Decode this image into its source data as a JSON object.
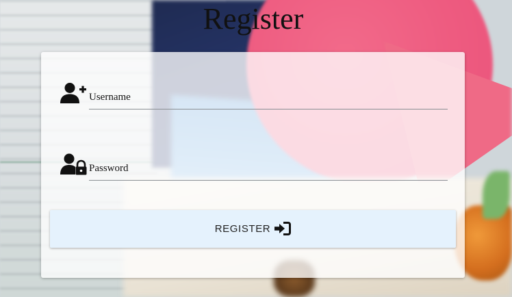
{
  "page": {
    "title": "Register"
  },
  "form": {
    "username": {
      "placeholder": "Username",
      "value": "",
      "icon": "user-plus-icon"
    },
    "password": {
      "placeholder": "Password",
      "value": "",
      "icon": "user-lock-icon"
    },
    "submit": {
      "label": "REGISTER",
      "icon": "sign-in-icon",
      "background": "#e5f2fd"
    }
  },
  "colors": {
    "title_text": "#111111",
    "card_background": "#ffffff",
    "button_background": "#e5f2fd",
    "input_underline": "#8a8f94"
  }
}
